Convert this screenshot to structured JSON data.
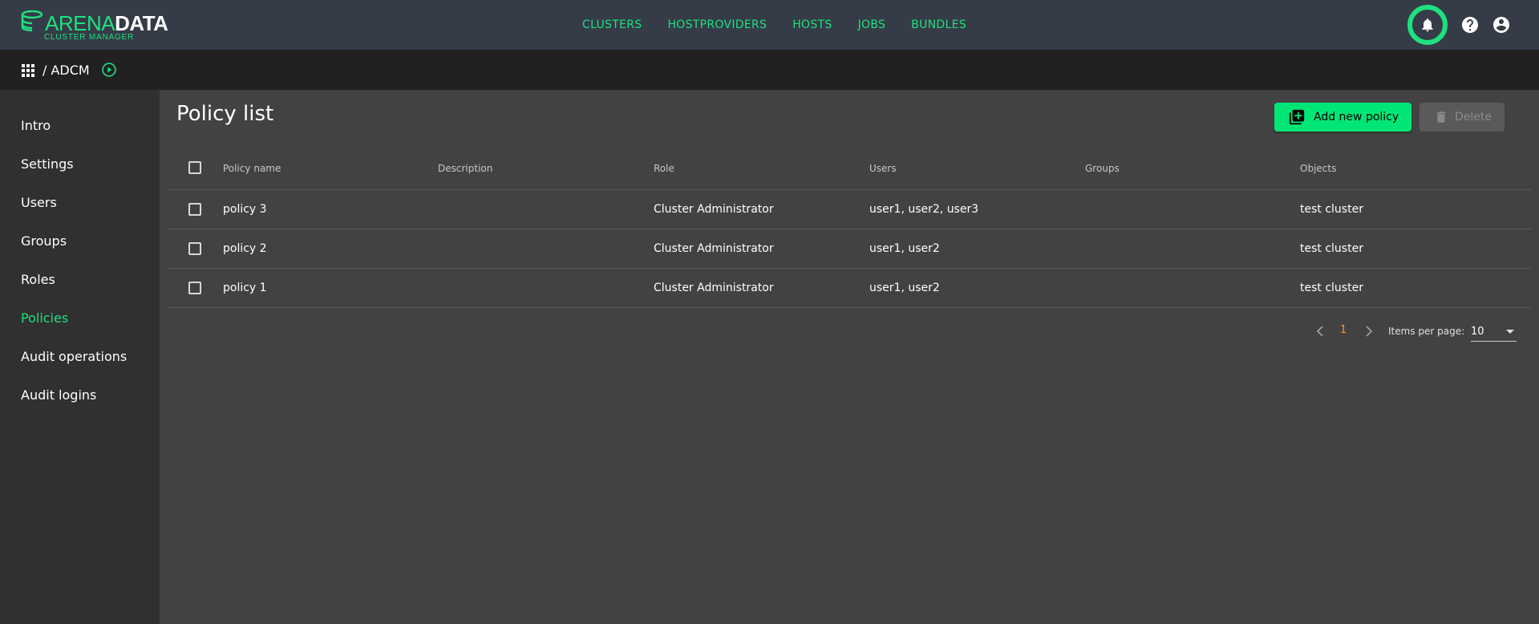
{
  "brand": {
    "name_part1": "ARENA",
    "name_part2": "DATA",
    "subtitle": "CLUSTER MANAGER",
    "color": "#1ee07f"
  },
  "nav": {
    "items": [
      "CLUSTERS",
      "HOSTPROVIDERS",
      "HOSTS",
      "JOBS",
      "BUNDLES"
    ]
  },
  "top_icons": [
    "bell-icon",
    "help-icon",
    "account-icon"
  ],
  "breadcrumb": {
    "text": "/ ADCM",
    "icons": [
      "apps-icon",
      "play-circle-icon"
    ]
  },
  "sidebar": {
    "items": [
      {
        "label": "Intro"
      },
      {
        "label": "Settings"
      },
      {
        "label": "Users"
      },
      {
        "label": "Groups"
      },
      {
        "label": "Roles"
      },
      {
        "label": "Policies",
        "active": true
      },
      {
        "label": "Audit operations"
      },
      {
        "label": "Audit logins"
      }
    ]
  },
  "main": {
    "title": "Policy list",
    "add_button": "Add new policy",
    "delete_button": "Delete"
  },
  "table": {
    "columns": [
      "Policy name",
      "Description",
      "Role",
      "Users",
      "Groups",
      "Objects"
    ],
    "rows": [
      {
        "name": "policy 3",
        "description": "",
        "role": "Cluster Administrator",
        "users": "user1, user2, user3",
        "groups": "",
        "objects": "test cluster"
      },
      {
        "name": "policy 2",
        "description": "",
        "role": "Cluster Administrator",
        "users": "user1, user2",
        "groups": "",
        "objects": "test cluster"
      },
      {
        "name": "policy 1",
        "description": "",
        "role": "Cluster Administrator",
        "users": "user1, user2",
        "groups": "",
        "objects": "test cluster"
      }
    ]
  },
  "paginator": {
    "current_page": "1",
    "items_per_page_label": "Items per page:",
    "items_per_page_value": "10"
  },
  "colors": {
    "accent": "#1ee07f",
    "primary_button": "#00e676",
    "page_active": "#ff9800",
    "topbar": "#353c47",
    "background": "#424242"
  }
}
